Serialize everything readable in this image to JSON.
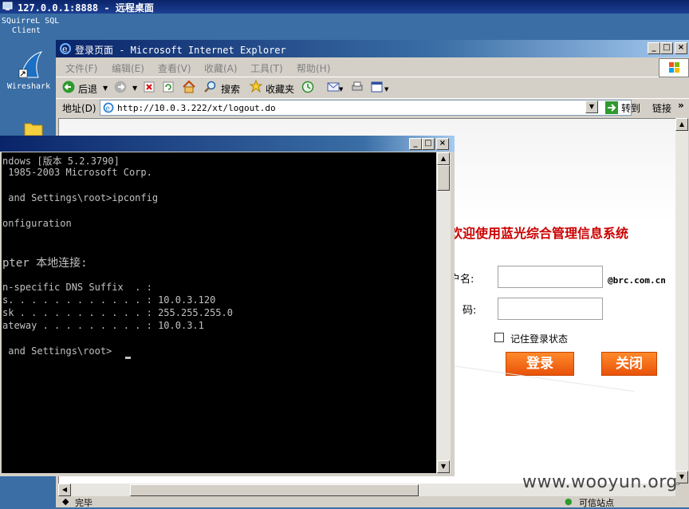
{
  "remote_desktop": {
    "title": "127.0.0.1:8888 - 远程桌面"
  },
  "desktop": {
    "icons": [
      {
        "label": "SQuirreL SQL\nClient"
      },
      {
        "label": "Wireshark"
      }
    ]
  },
  "ie": {
    "title": "登录页面 - Microsoft Internet Explorer",
    "menu": [
      "文件(F)",
      "编辑(E)",
      "查看(V)",
      "收藏(A)",
      "工具(T)",
      "帮助(H)"
    ],
    "toolbar": {
      "back": "后退",
      "search": "搜索",
      "favorites": "收藏夹"
    },
    "address": {
      "label": "地址(D)",
      "url": "http://10.0.3.222/xt/logout.do",
      "go": "转到",
      "links": "链接"
    },
    "status": {
      "left": "完毕",
      "right": "可信站点"
    }
  },
  "login": {
    "welcome": "欢迎使用蓝光综合管理信息系统",
    "user_label": "户名:",
    "pass_label": "码:",
    "email_suffix": "@brc.com.cn",
    "remember": "记住登录状态",
    "login_button": "登录",
    "close_button": "关闭"
  },
  "cmd": {
    "lines": [
      "ndows [版本 5.2.3790]",
      " 1985-2003 Microsoft Corp.",
      "",
      " and Settings\\root>ipconfig",
      "",
      "onfiguration",
      "",
      "",
      "pter 本地连接:",
      "",
      "n-specific DNS Suffix  . :",
      "s. . . . . . . . . . . . : 10.0.3.120",
      "sk . . . . . . . . . . . : 255.255.255.0",
      "ateway . . . . . . . . . : 10.0.3.1",
      "",
      " and Settings\\root>"
    ]
  },
  "watermark": "www.wooyun.org"
}
